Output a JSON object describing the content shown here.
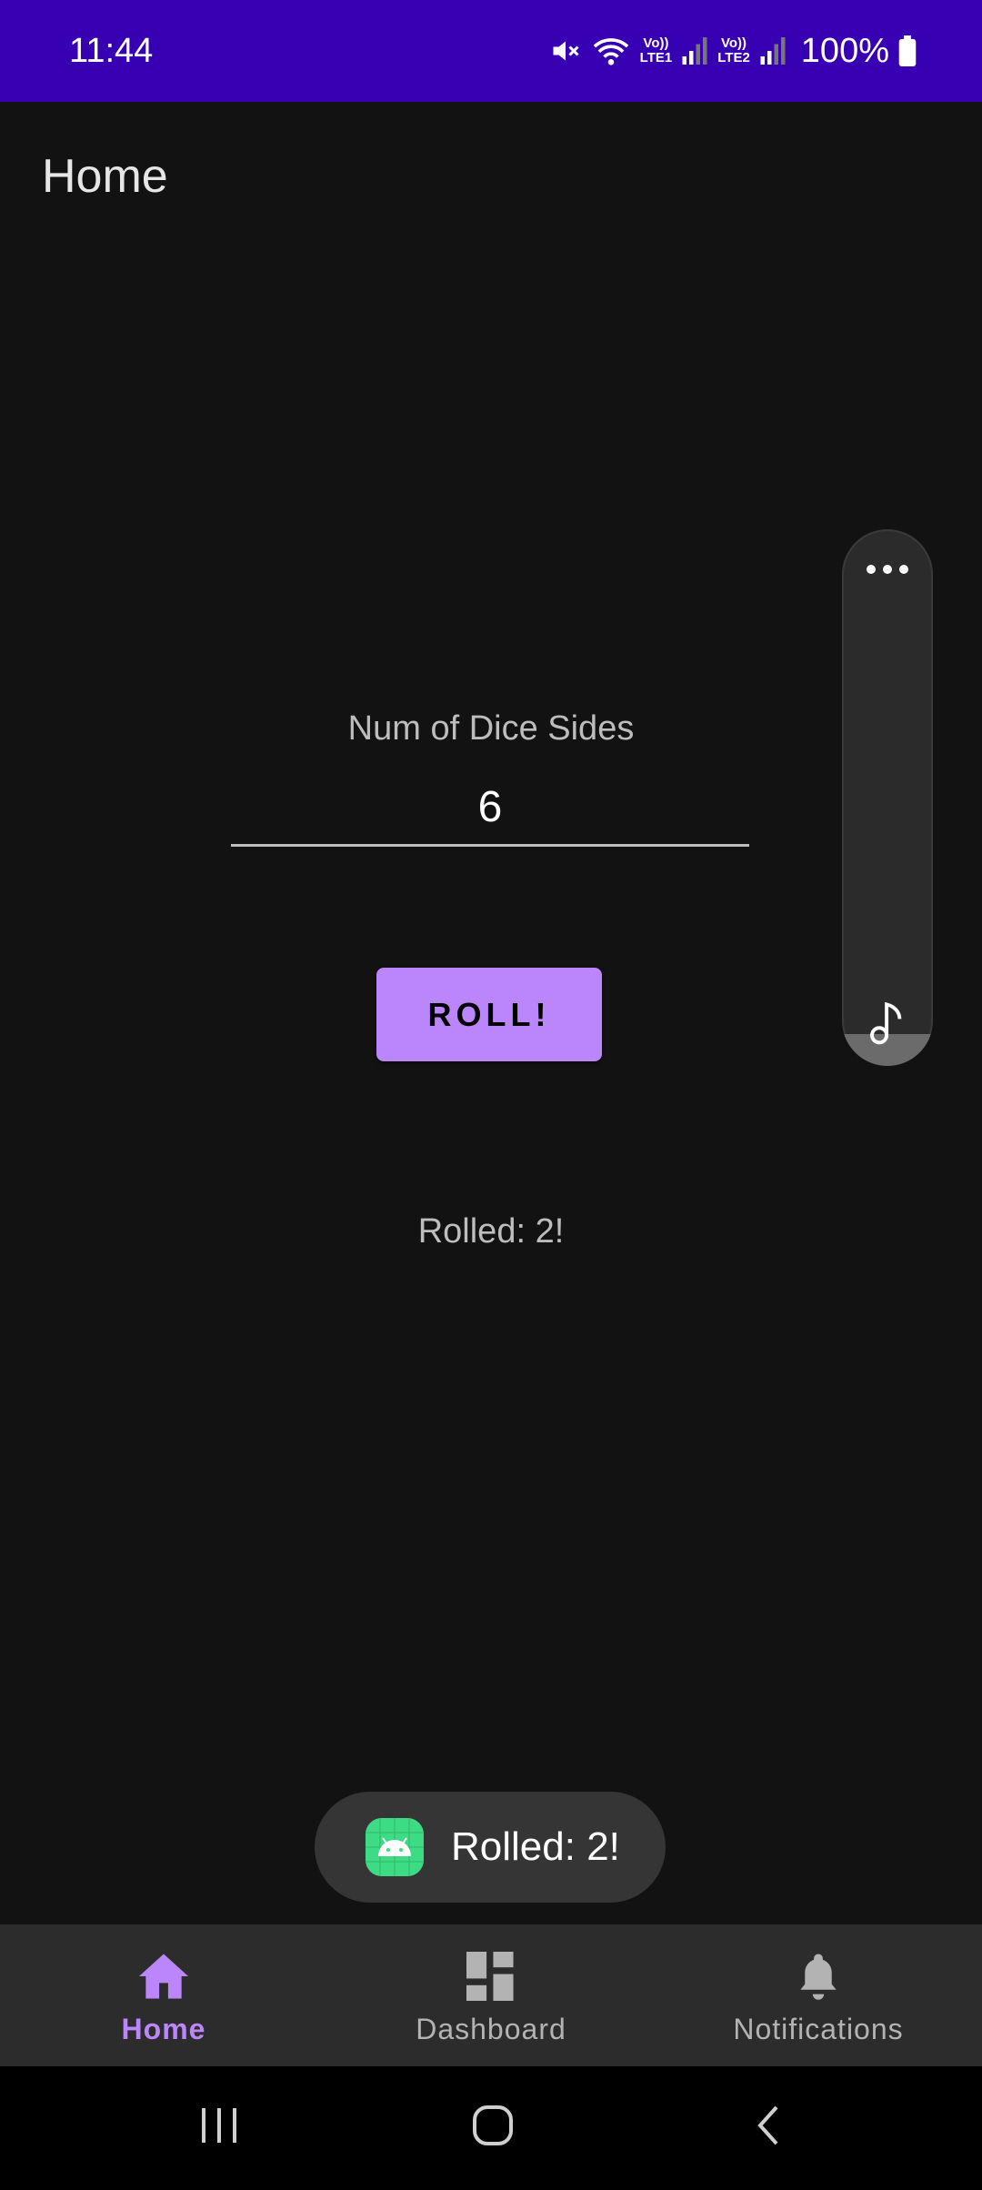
{
  "status_bar": {
    "time": "11:44",
    "sim1_label_top": "Vo))",
    "sim1_label_bottom": "LTE1",
    "sim2_label_top": "Vo))",
    "sim2_label_bottom": "LTE2",
    "battery": "100%",
    "background_color": "#3700B3"
  },
  "app_bar": {
    "title": "Home"
  },
  "main": {
    "sides_label": "Num of Dice Sides",
    "sides_value": "6",
    "roll_button_label": "ROLL!",
    "result_text": "Rolled: 2!",
    "accent_color": "#BB86FC"
  },
  "volume_panel": {
    "more_icon": "more-horizontal-icon",
    "media_icon": "music-note-icon",
    "level_fraction": 0.06
  },
  "toast": {
    "icon": "android-app-icon",
    "text": "Rolled: 2!"
  },
  "bottom_nav": {
    "items": [
      {
        "label": "Home",
        "icon": "home-icon",
        "active": true
      },
      {
        "label": "Dashboard",
        "icon": "dashboard-icon",
        "active": false
      },
      {
        "label": "Notifications",
        "icon": "bell-icon",
        "active": false
      }
    ]
  },
  "system_nav": {
    "recents_icon": "recents-icon",
    "home_icon": "home-circle-icon",
    "back_icon": "back-icon"
  }
}
